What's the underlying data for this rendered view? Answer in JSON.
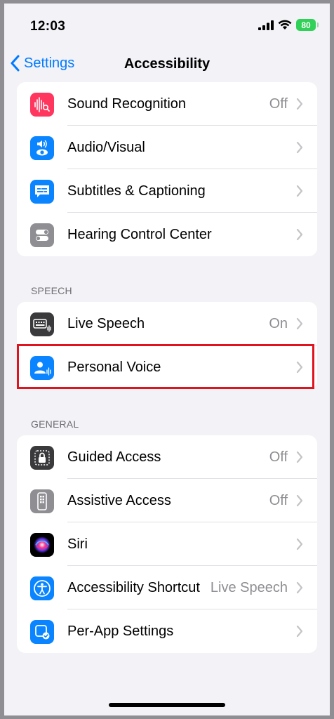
{
  "status_bar": {
    "time": "12:03",
    "battery": "80"
  },
  "nav": {
    "back_label": "Settings",
    "title": "Accessibility"
  },
  "hearing_group": [
    {
      "label": "Sound Recognition",
      "value": "Off",
      "icon": "sound-recognition-icon",
      "color": "#ff375f"
    },
    {
      "label": "Audio/Visual",
      "value": "",
      "icon": "audio-visual-icon",
      "color": "#0a84ff"
    },
    {
      "label": "Subtitles & Captioning",
      "value": "",
      "icon": "subtitles-icon",
      "color": "#0a84ff"
    },
    {
      "label": "Hearing Control Center",
      "value": "",
      "icon": "hearing-control-center-icon",
      "color": "#8e8e93"
    }
  ],
  "speech_section": {
    "header": "SPEECH",
    "items": [
      {
        "label": "Live Speech",
        "value": "On",
        "icon": "keyboard-speech-icon",
        "color": "#3a3a3c"
      },
      {
        "label": "Personal Voice",
        "value": "",
        "icon": "personal-voice-icon",
        "color": "#0a84ff"
      }
    ]
  },
  "general_section": {
    "header": "GENERAL",
    "items": [
      {
        "label": "Guided Access",
        "value": "Off",
        "icon": "guided-access-icon",
        "color": "#3a3a3c"
      },
      {
        "label": "Assistive Access",
        "value": "Off",
        "icon": "assistive-access-icon",
        "color": "#8e8e93"
      },
      {
        "label": "Siri",
        "value": "",
        "icon": "siri-icon",
        "color": "#000000"
      },
      {
        "label": "Accessibility Shortcut",
        "value": "Live Speech",
        "icon": "accessibility-shortcut-icon",
        "color": "#0a84ff"
      },
      {
        "label": "Per-App Settings",
        "value": "",
        "icon": "per-app-settings-icon",
        "color": "#0a84ff"
      }
    ]
  },
  "colors": {
    "accent": "#007aff",
    "highlight": "#e0141e"
  }
}
